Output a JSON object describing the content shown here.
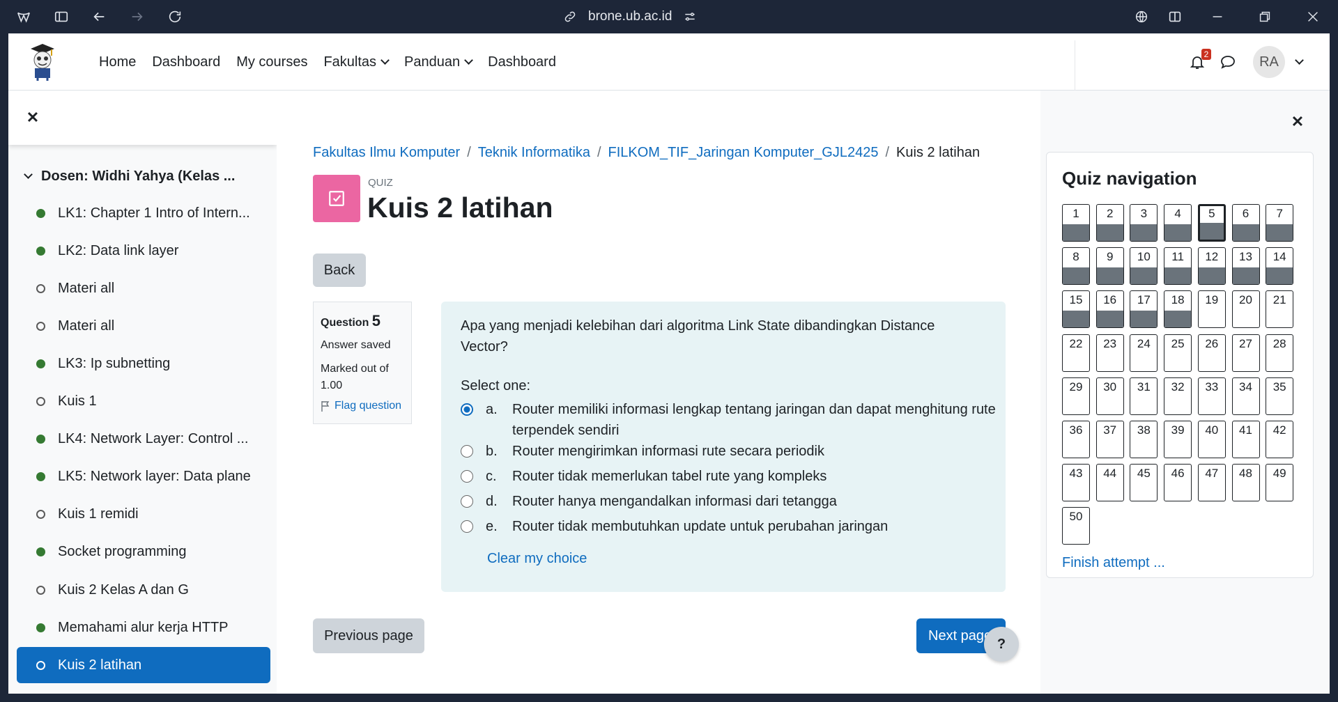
{
  "browser": {
    "url": "brone.ub.ac.id"
  },
  "nav": {
    "links": [
      "Home",
      "Dashboard",
      "My courses",
      "Fakultas",
      "Panduan",
      "Dashboard"
    ],
    "notifications": "2",
    "avatar": "RA"
  },
  "sidebar": {
    "section": "Dosen: Widhi Yahya (Kelas ...",
    "items": [
      {
        "label": "LK1: Chapter 1 Intro of Intern...",
        "done": true
      },
      {
        "label": "LK2: Data link layer",
        "done": true
      },
      {
        "label": "Materi all",
        "done": false
      },
      {
        "label": "Materi all",
        "done": false
      },
      {
        "label": "LK3: Ip subnetting",
        "done": true
      },
      {
        "label": "Kuis 1",
        "done": false
      },
      {
        "label": "LK4: Network Layer: Control ...",
        "done": true
      },
      {
        "label": "LK5: Network layer: Data plane",
        "done": true
      },
      {
        "label": "Kuis 1 remidi",
        "done": false
      },
      {
        "label": "Socket programming",
        "done": true
      },
      {
        "label": "Kuis 2 Kelas A dan G",
        "done": false
      },
      {
        "label": "Memahami alur kerja HTTP",
        "done": true
      },
      {
        "label": "Kuis 2 latihan",
        "done": false
      }
    ]
  },
  "breadcrumb": [
    "Fakultas Ilmu Komputer",
    "Teknik Informatika",
    "FILKOM_TIF_Jaringan Komputer_GJL2425",
    "Kuis 2 latihan"
  ],
  "quiz": {
    "label": "QUIZ",
    "title": "Kuis 2 latihan",
    "back": "Back",
    "question_word": "Question",
    "question_number": "5",
    "status": "Answer saved",
    "marked": "Marked out of 1.00",
    "flag": "Flag question",
    "question_text": "Apa yang menjadi kelebihan dari algoritma Link State dibandingkan Distance Vector?",
    "select_label": "Select one:",
    "options": [
      {
        "letter": "a.",
        "text": "Router memiliki informasi lengkap tentang jaringan dan dapat menghitung rute terpendek sendiri",
        "selected": true
      },
      {
        "letter": "b.",
        "text": "Router mengirimkan informasi rute secara periodik",
        "selected": false
      },
      {
        "letter": "c.",
        "text": "Router tidak memerlukan tabel rute yang kompleks",
        "selected": false
      },
      {
        "letter": "d.",
        "text": "Router hanya mengandalkan informasi dari tetangga",
        "selected": false
      },
      {
        "letter": "e.",
        "text": "Router tidak membutuhkan update untuk perubahan jaringan",
        "selected": false
      }
    ],
    "clear": "Clear my choice",
    "prev": "Previous page",
    "next": "Next page",
    "help": "?"
  },
  "quiz_nav": {
    "title": "Quiz navigation",
    "total": 50,
    "current": 5,
    "answered": [
      1,
      2,
      3,
      4,
      5,
      6,
      7,
      8,
      9,
      10,
      11,
      12,
      13,
      14,
      15,
      16,
      17,
      18
    ],
    "finish": "Finish attempt ..."
  }
}
